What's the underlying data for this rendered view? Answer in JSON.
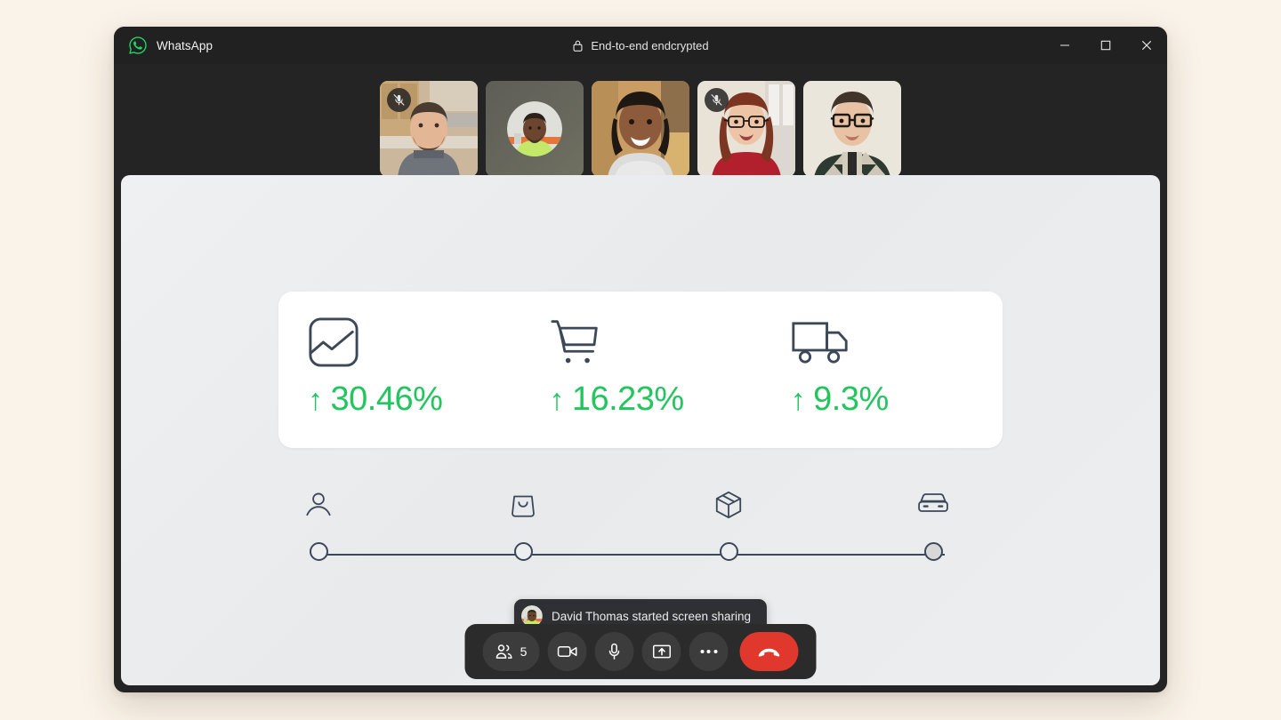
{
  "window": {
    "app_name": "WhatsApp",
    "logo_icon": "whatsapp-icon",
    "encryption_label": "End-to-end endcrypted",
    "lock_icon": "lock-icon",
    "controls": {
      "minimize": "minimize-icon",
      "maximize": "maximize-icon",
      "close": "close-icon"
    }
  },
  "colors": {
    "page_background": "#faf3e9",
    "window_background": "#242424",
    "titlebar": "#212121",
    "brand_green": "#25d366",
    "metric_green": "#22c55e",
    "ink": "#3c4858",
    "end_call_red": "#e0382c",
    "shared_screen": "#eceef0"
  },
  "filmstrip": {
    "participants": [
      {
        "name": "participant-1",
        "muted": true,
        "kind": "video"
      },
      {
        "name": "participant-2",
        "muted": false,
        "kind": "avatar"
      },
      {
        "name": "participant-3",
        "muted": false,
        "kind": "video"
      },
      {
        "name": "participant-4",
        "muted": true,
        "kind": "video"
      },
      {
        "name": "participant-5",
        "muted": false,
        "kind": "video"
      }
    ],
    "mute_icon": "microphone-muted-icon"
  },
  "shared_screen": {
    "metrics": [
      {
        "icon": "image-chart-icon",
        "arrow": "↑",
        "value": "30.46%"
      },
      {
        "icon": "shopping-cart-icon",
        "arrow": "↑",
        "value": "16.23%"
      },
      {
        "icon": "delivery-truck-icon",
        "arrow": "↑",
        "value": "9.3%"
      }
    ],
    "stepper": {
      "steps": [
        {
          "icon": "person-icon",
          "position_pct": 0,
          "filled": false
        },
        {
          "icon": "shopping-bag-icon",
          "position_pct": 32,
          "filled": false
        },
        {
          "icon": "package-box-icon",
          "position_pct": 64,
          "filled": false
        },
        {
          "icon": "car-icon",
          "position_pct": 100,
          "filled": true
        }
      ]
    }
  },
  "toast": {
    "avatar_icon": "user-avatar",
    "message": "David Thomas started screen sharing"
  },
  "control_bar": {
    "participants": {
      "icon": "people-icon",
      "count": "5"
    },
    "camera": {
      "icon": "video-camera-icon"
    },
    "microphone": {
      "icon": "microphone-icon"
    },
    "share_screen": {
      "icon": "share-screen-icon"
    },
    "more": {
      "icon": "more-options-icon"
    },
    "end_call": {
      "icon": "end-call-icon"
    }
  }
}
